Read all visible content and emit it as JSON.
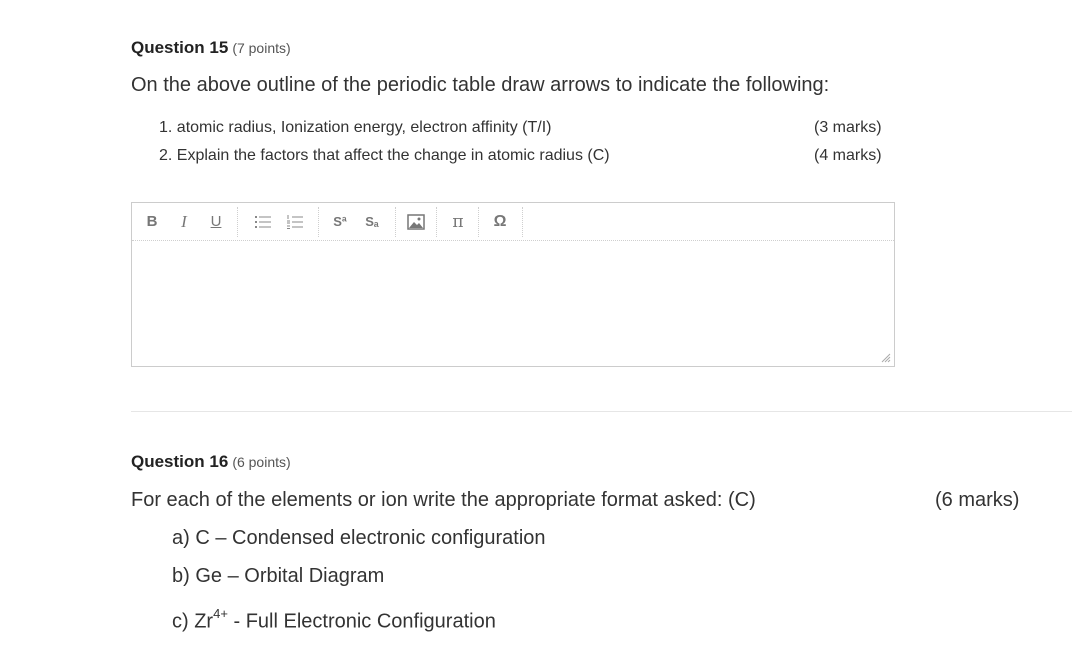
{
  "q15": {
    "title": "Question 15",
    "points": "(7 points)",
    "prompt": "On the above outline of the periodic table draw arrows to indicate the following:",
    "items": [
      {
        "text": "1. atomic radius, Ionization energy, electron affinity (T/I)",
        "marks": "(3 marks)"
      },
      {
        "text": "2. Explain the factors that affect the change in atomic radius (C)",
        "marks": "(4 marks)"
      }
    ]
  },
  "editor": {
    "toolbar": {
      "bold": "B",
      "italic": "I",
      "underline": "U",
      "superscript": "Sª",
      "subscript": "Sₐ",
      "pi": "π",
      "omega": "Ω"
    },
    "icons": [
      "bold-icon",
      "italic-icon",
      "underline-icon",
      "bullet-list-icon",
      "numbered-list-icon",
      "superscript-icon",
      "subscript-icon",
      "image-icon",
      "pi-icon",
      "omega-icon",
      "resize-grip-icon"
    ]
  },
  "q16": {
    "title": "Question 16",
    "points": "(6 points)",
    "prompt": "For each of the elements or ion write the appropriate format asked: (C)",
    "marks": "(6 marks)",
    "item_a": "a) C – Condensed electronic configuration",
    "item_b": "b) Ge – Orbital Diagram",
    "item_c_prefix": "c) Zr",
    "item_c_sup": "4+",
    "item_c_suffix": " - Full Electronic Configuration"
  }
}
